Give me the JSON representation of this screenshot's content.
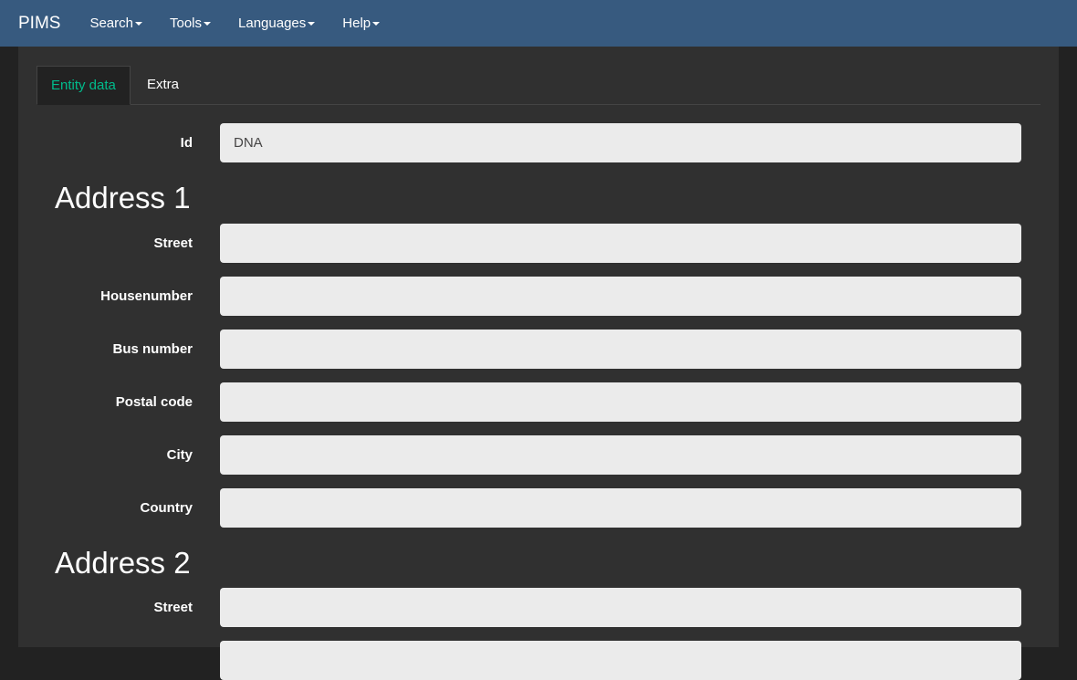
{
  "navbar": {
    "brand": "PIMS",
    "menus": [
      {
        "label": "Search"
      },
      {
        "label": "Tools"
      },
      {
        "label": "Languages"
      },
      {
        "label": "Help"
      }
    ]
  },
  "tabs": [
    {
      "label": "Entity data",
      "active": true
    },
    {
      "label": "Extra",
      "active": false
    }
  ],
  "form": {
    "id": {
      "label": "Id",
      "value": "DNA"
    },
    "address1": {
      "heading": "Address 1",
      "fields": [
        {
          "label": "Street",
          "value": ""
        },
        {
          "label": "Housenumber",
          "value": ""
        },
        {
          "label": "Bus number",
          "value": ""
        },
        {
          "label": "Postal code",
          "value": ""
        },
        {
          "label": "City",
          "value": ""
        },
        {
          "label": "Country",
          "value": ""
        }
      ]
    },
    "address2": {
      "heading": "Address 2",
      "fields": [
        {
          "label": "Street",
          "value": ""
        },
        {
          "label": "",
          "value": ""
        }
      ]
    }
  },
  "colors": {
    "navbar_bg": "#375a7f",
    "page_bg": "#222222",
    "panel_bg": "#303030",
    "active_tab_text": "#00bc8c",
    "input_bg": "#ebebeb"
  }
}
